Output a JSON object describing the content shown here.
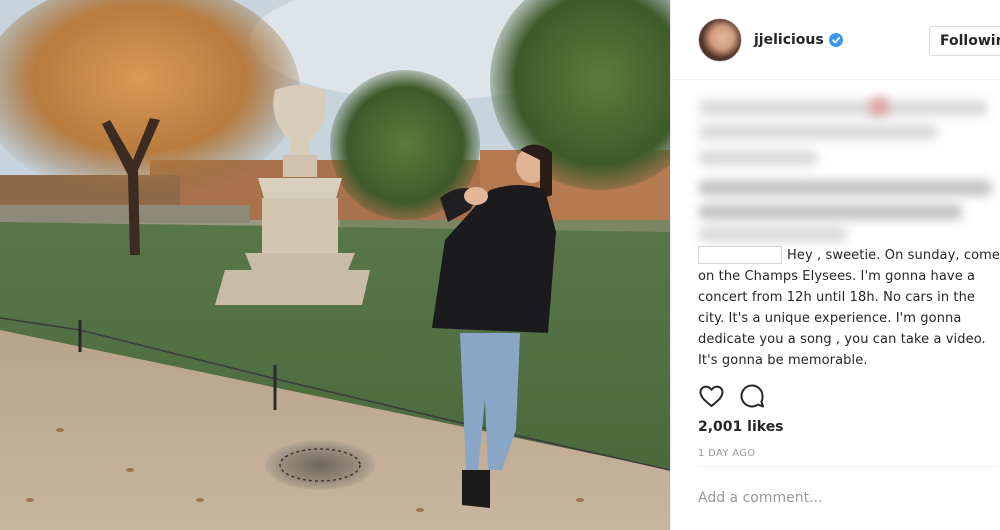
{
  "post": {
    "username": "jjelicious",
    "verified": true,
    "follow_label": "Following",
    "caption": "Hey , sweetie. On sunday, come on the Champs Elysees. I'm gonna have a concert from 12h until 18h. No cars in the city. It's a unique experience. I'm gonna dedicate you a song , you can take a video. It's gonna be memorable.",
    "likes": "2,001 likes",
    "timestamp": "1 DAY AGO",
    "comment_placeholder": "Add a comment..."
  },
  "icons": {
    "like": "heart-icon",
    "comment": "comment-icon",
    "verified": "verified-badge-icon"
  },
  "colors": {
    "verified_badge": "#3897f0",
    "text_primary": "#262626",
    "text_secondary": "#999999",
    "border": "#dbdbdb"
  }
}
